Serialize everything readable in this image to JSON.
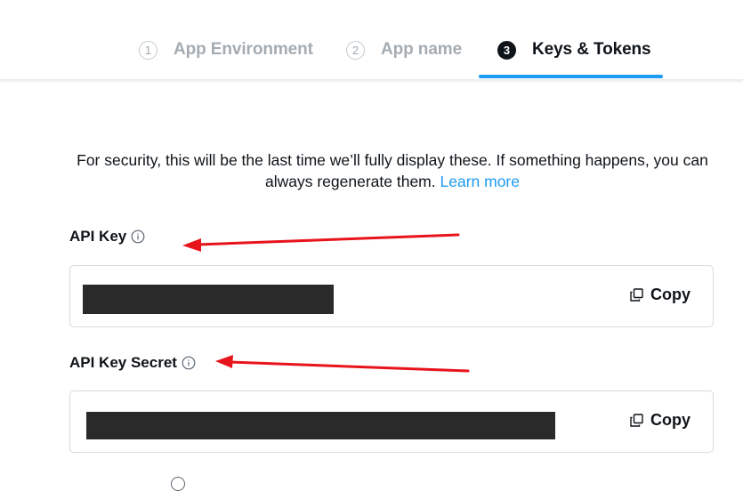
{
  "stepper": {
    "steps": [
      {
        "num": "1",
        "label": "App Environment"
      },
      {
        "num": "2",
        "label": "App name"
      },
      {
        "num": "3",
        "label": "Keys & Tokens"
      }
    ],
    "active_step": 3
  },
  "notice": {
    "text": "For security, this will be the last time we’ll fully display these. If something happens, you can always regenerate them.",
    "link": "Learn more"
  },
  "fields": [
    {
      "label": "API Key",
      "value": "[redacted]",
      "copy_label": "Copy"
    },
    {
      "label": "API Key Secret",
      "value": "[redacted]",
      "copy_label": "Copy"
    }
  ],
  "colors": {
    "accent": "#1d9bf0",
    "annotation_arrow": "#e8141c",
    "redaction": "#2a2a2a"
  },
  "icons": [
    "info-icon",
    "copy-icon"
  ]
}
